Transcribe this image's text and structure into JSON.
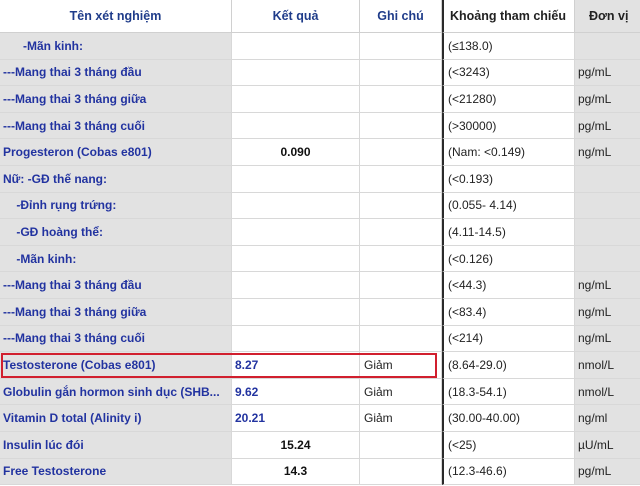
{
  "columns": {
    "name": "Tên xét nghiệm",
    "result": "Kết quả",
    "note": "Ghi chú",
    "ref": "Khoảng tham chiếu",
    "unit": "Đơn vị"
  },
  "rows": [
    {
      "name": "      -Mãn kinh:",
      "result": "",
      "note": "",
      "ref": "(≤138.0)",
      "unit": ""
    },
    {
      "name": "---Mang thai 3 tháng đầu",
      "result": "",
      "note": "",
      "ref": "(<3243)",
      "unit": "pg/mL"
    },
    {
      "name": "---Mang thai 3 tháng giữa",
      "result": "",
      "note": "",
      "ref": "(<21280)",
      "unit": "pg/mL"
    },
    {
      "name": "---Mang thai 3 tháng cuối",
      "result": "",
      "note": "",
      "ref": "(>30000)",
      "unit": "pg/mL"
    },
    {
      "name": "Progesteron (Cobas e801)",
      "result": "0.090",
      "note": "",
      "ref": "(Nam: <0.149)",
      "unit": "ng/mL"
    },
    {
      "name": "Nữ: -GĐ thế nang:",
      "result": "",
      "note": "",
      "ref": "(<0.193)",
      "unit": ""
    },
    {
      "name": "    -Đỉnh rụng trứng:",
      "result": "",
      "note": "",
      "ref": "(0.055- 4.14)",
      "unit": ""
    },
    {
      "name": "    -GĐ hoàng thể:",
      "result": "",
      "note": "",
      "ref": "(4.11-14.5)",
      "unit": ""
    },
    {
      "name": "    -Mãn kinh:",
      "result": "",
      "note": "",
      "ref": "(<0.126)",
      "unit": ""
    },
    {
      "name": "---Mang thai 3 tháng đầu",
      "result": "",
      "note": "",
      "ref": "(<44.3)",
      "unit": "ng/mL"
    },
    {
      "name": "---Mang thai 3 tháng giữa",
      "result": "",
      "note": "",
      "ref": "(<83.4)",
      "unit": "ng/mL"
    },
    {
      "name": "---Mang thai 3 tháng cuối",
      "result": "",
      "note": "",
      "ref": "(<214)",
      "unit": "ng/mL"
    },
    {
      "name": "Testosterone (Cobas e801)",
      "result": "8.27",
      "note": "Giảm",
      "ref": "(8.64-29.0)",
      "unit": "nmol/L"
    },
    {
      "name": "Globulin gắn hormon sinh dục (SHB...",
      "result": "9.62",
      "note": "Giảm",
      "ref": "(18.3-54.1)",
      "unit": "nmol/L"
    },
    {
      "name": "Vitamin D total (Alinity i)",
      "result": "20.21",
      "note": "Giảm",
      "ref": "(30.00-40.00)",
      "unit": "ng/ml"
    },
    {
      "name": "Insulin lúc đói",
      "result": "15.24",
      "note": "",
      "ref": "(<25)",
      "unit": "µU/mL"
    },
    {
      "name": "Free Testosterone",
      "result": "14.3",
      "note": "",
      "ref": "(12.3-46.6)",
      "unit": "pg/mL"
    }
  ],
  "highlighted_row": "Testosterone (Cobas e801)",
  "colors": {
    "highlight_border": "#d11f2e",
    "name_text": "#2233a0",
    "header_text": "#1f3c8a"
  }
}
